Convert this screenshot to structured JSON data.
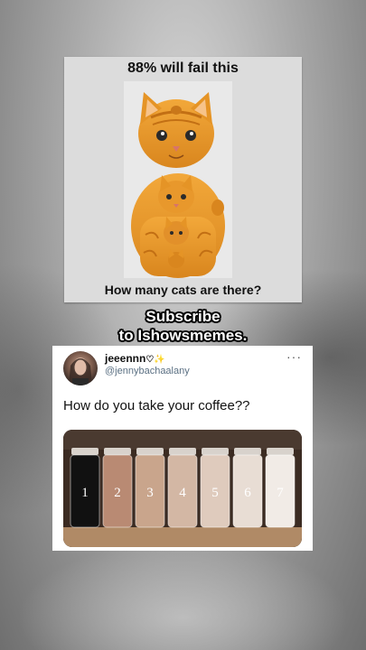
{
  "meme": {
    "top_text": "88% will fail this",
    "bottom_text": "How many cats are there?"
  },
  "caption": {
    "line1": "Subscribe",
    "line2": "to Ishowsmemes."
  },
  "tweet": {
    "display_name": "jeeennn",
    "name_emojis": "♡✨",
    "handle": "@jennybachaalany",
    "more_label": "···",
    "text": "How do you take your coffee??",
    "jars": [
      "1",
      "2",
      "3",
      "4",
      "5",
      "6",
      "7"
    ],
    "jar_colors": [
      "#111111",
      "#b98a73",
      "#c9a58c",
      "#d3b7a4",
      "#dfcbbd",
      "#e8ddd4",
      "#f1ebe6"
    ]
  }
}
